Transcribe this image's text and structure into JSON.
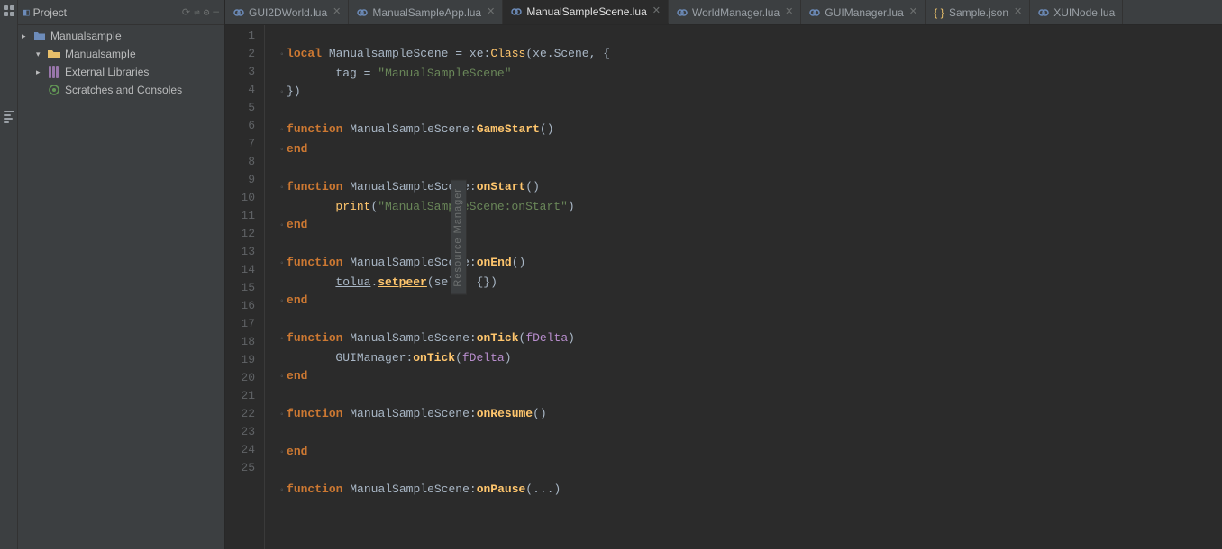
{
  "sidebar": {
    "header": {
      "title": "Project",
      "icons": [
        "gear",
        "split",
        "settings",
        "minimize"
      ]
    },
    "tree": [
      {
        "id": "manualsample",
        "label": "ManualsampIe",
        "type": "root-folder",
        "indent": 0,
        "expanded": true,
        "arrow": "▾"
      },
      {
        "id": "external-libraries",
        "label": "External Libraries",
        "type": "ext-lib",
        "indent": 1,
        "expanded": false,
        "arrow": "▸"
      },
      {
        "id": "scratches",
        "label": "Scratches and Consoles",
        "type": "scratches",
        "indent": 1,
        "expanded": false,
        "arrow": ""
      }
    ]
  },
  "tabs": [
    {
      "id": "gui2dworld",
      "label": "GUI2DWorld.lua",
      "type": "lua",
      "active": false,
      "closable": true
    },
    {
      "id": "manualsampleapp",
      "label": "ManualSampleApp.lua",
      "type": "lua",
      "active": false,
      "closable": true
    },
    {
      "id": "manualsamplescene",
      "label": "ManualSampleScene.lua",
      "type": "lua",
      "active": true,
      "closable": true
    },
    {
      "id": "worldmanager",
      "label": "WorldManager.lua",
      "type": "lua",
      "active": false,
      "closable": true
    },
    {
      "id": "guimanager",
      "label": "GUIManager.lua",
      "type": "lua",
      "active": false,
      "closable": true
    },
    {
      "id": "samplejson",
      "label": "Sample.json",
      "type": "json",
      "active": false,
      "closable": true
    },
    {
      "id": "xuinode",
      "label": "XUINode.lua",
      "type": "lua",
      "active": false,
      "closable": false
    }
  ],
  "code": {
    "lines": [
      {
        "num": 1,
        "content": ""
      },
      {
        "num": 2,
        "content": "local ManualsampleScene = xe:Class(xe.Scene, {"
      },
      {
        "num": 3,
        "content": "    tag = \"ManualSampleScene\""
      },
      {
        "num": 4,
        "content": "})"
      },
      {
        "num": 5,
        "content": ""
      },
      {
        "num": 6,
        "content": "function ManualSampleScene:GameStart()"
      },
      {
        "num": 7,
        "content": "end"
      },
      {
        "num": 8,
        "content": ""
      },
      {
        "num": 9,
        "content": "function ManualSampleScene:onStart()"
      },
      {
        "num": 10,
        "content": "    print(\"ManualSampleScene:onStart\")"
      },
      {
        "num": 11,
        "content": "end"
      },
      {
        "num": 12,
        "content": ""
      },
      {
        "num": 13,
        "content": "function ManualSampleScene:onEnd()"
      },
      {
        "num": 14,
        "content": "    tolua.setpeer(self, {})"
      },
      {
        "num": 15,
        "content": "end"
      },
      {
        "num": 16,
        "content": ""
      },
      {
        "num": 17,
        "content": "function ManualSampleScene:onTick(fDelta)"
      },
      {
        "num": 18,
        "content": "    GUIManager:onTick(fDelta)"
      },
      {
        "num": 19,
        "content": "end"
      },
      {
        "num": 20,
        "content": ""
      },
      {
        "num": 21,
        "content": "function ManualSampleScene:onResume()"
      },
      {
        "num": 22,
        "content": ""
      },
      {
        "num": 23,
        "content": "end"
      },
      {
        "num": 24,
        "content": ""
      },
      {
        "num": 25,
        "content": "function ManualSampleScene:onPause(...)"
      }
    ]
  },
  "resource_tab": {
    "label": "Resource Manager"
  }
}
